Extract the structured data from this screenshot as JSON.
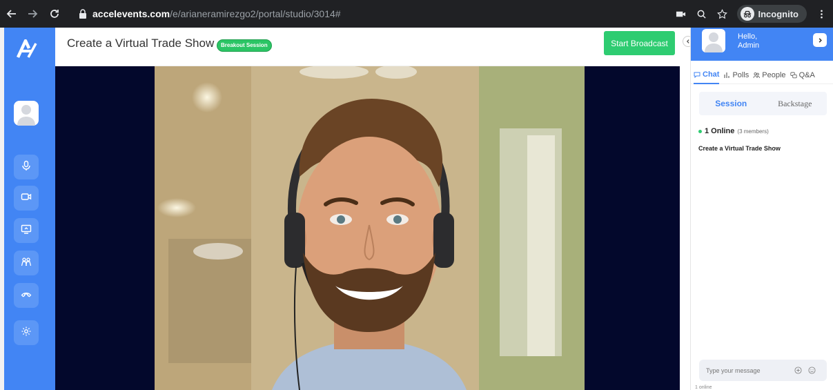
{
  "browser": {
    "url_domain": "accelevents.com",
    "url_path": "/e/arianeramirezgo2/portal/studio/3014#",
    "profile_label": "Incognito"
  },
  "header": {
    "title": "Create a Virtual Trade Show",
    "badge": "Breakout Session",
    "start_broadcast_label": "Start Broadcast"
  },
  "panel": {
    "greeting": "Hello,",
    "user_name": "Admin",
    "tabs": [
      {
        "label": "Chat",
        "icon": "chat-icon"
      },
      {
        "label": "Polls",
        "icon": "polls-icon"
      },
      {
        "label": "People",
        "icon": "people-icon"
      },
      {
        "label": "Q&A",
        "icon": "qa-icon"
      }
    ],
    "segments": [
      "Session",
      "Backstage"
    ],
    "online_count": "1 Online",
    "members": "(3 members)",
    "session_name": "Create a Virtual Trade Show",
    "message_placeholder": "Type your message",
    "footer_status": "1 online"
  },
  "colors": {
    "brand_blue": "#4285f4",
    "broadcast_green": "#2ecc71",
    "stage_background": "#03082c"
  }
}
